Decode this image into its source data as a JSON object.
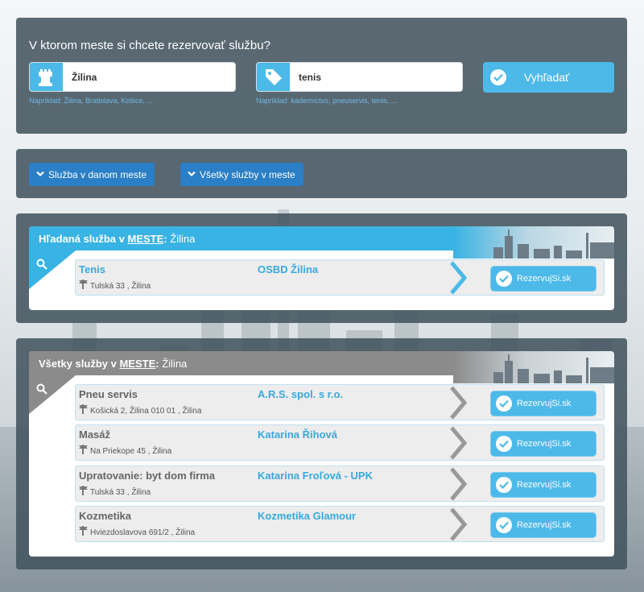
{
  "search": {
    "question": "V ktorom meste si chcete rezervovať službu?",
    "city_value": "Žilina",
    "city_hint": "Napríklad: Žilina, Bratislava, Košice, ...",
    "service_value": "tenis",
    "service_hint": "Napríklad: kaderníctvo, pneuservis, tenis, ...",
    "button_label": "Vyhľadať"
  },
  "toggles": {
    "service_in_city": "Služba v danom meste",
    "all_services": "Všetky služby v meste"
  },
  "searched": {
    "title_prefix": "Hľadaná služba v",
    "title_city_word": "MESTE",
    "title_sep": ":",
    "title_city": "Žilina",
    "items": [
      {
        "name": "Tenis",
        "address": "Tulská 33 , Žilina",
        "provider": "OSBD Žilina",
        "button": "RezervujSi.sk"
      }
    ]
  },
  "all": {
    "title_prefix": "Všetky služby v",
    "title_city_word": "MESTE",
    "title_sep": ":",
    "title_city": "Žilina",
    "items": [
      {
        "name": "Pneu servis",
        "address": "Košická 2, Žilina 010 01 , Žilina",
        "provider": "A.R.S. spol. s r.o.",
        "button": "RezervujSi.sk"
      },
      {
        "name": "Masáž",
        "address": "Na Priekope 45 , Žilina",
        "provider": "Katarina Řihová",
        "button": "RezervujSi.sk"
      },
      {
        "name": "Upratovanie: byt dom firma",
        "address": "Tulská 33 , Žilina",
        "provider": "Katarina Froľová - UPK",
        "button": "RezervujSi.sk"
      },
      {
        "name": "Kozmetika",
        "address": "Hviezdoslavova 691/2 , Žilina",
        "provider": "Kozmetika Glamour",
        "button": "RezervujSi.sk"
      }
    ]
  },
  "colors": {
    "accent": "#4cb9e9",
    "toggle": "#2a7fc7",
    "panel": "#43545f",
    "header_gray": "#8b8b8b"
  },
  "icons": [
    "rook-icon",
    "tag-icon",
    "check-circle-icon",
    "chevron-down-icon",
    "search-icon",
    "signpost-icon",
    "chevron-right-icon"
  ]
}
